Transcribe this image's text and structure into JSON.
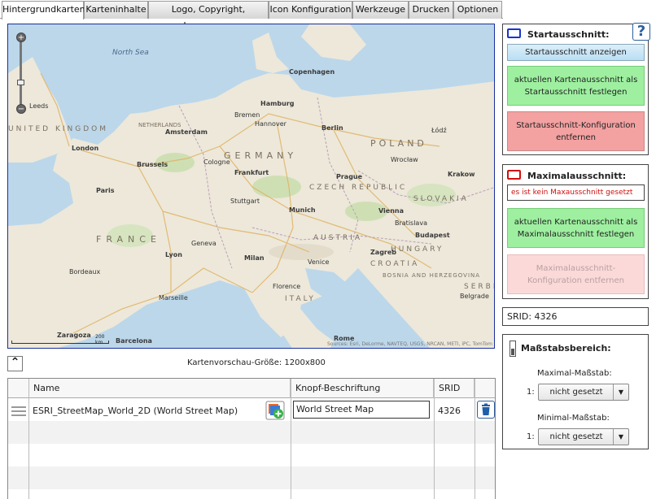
{
  "tabs": [
    {
      "label": "Hintergrundkarten",
      "active": true
    },
    {
      "label": "Karteninhalte",
      "active": false
    },
    {
      "label": "Logo, Copyright, Impressum",
      "active": false
    },
    {
      "label": "Icon Konfiguration",
      "active": false
    },
    {
      "label": "Werkzeuge",
      "active": false
    },
    {
      "label": "Drucken",
      "active": false
    },
    {
      "label": "Optionen",
      "active": false
    }
  ],
  "map": {
    "labels": {
      "north_sea": "North Sea",
      "united_kingdom": "UNITED KINGDOM",
      "netherlands": "NETHERLANDS",
      "france": "FRANCE",
      "germany": "GERMANY",
      "poland": "POLAND",
      "czech": "CZECH REPUBLIC",
      "austria": "AUSTRIA",
      "hungary": "HUNGARY",
      "slovakia": "SLOVAKIA",
      "italy": "ITALY",
      "croatia": "CROATIA",
      "bosnia": "BOSNIA AND HERZEGOVINA",
      "serbia": "SERBIA",
      "london": "London",
      "amsterdam": "Amsterdam",
      "brussels": "Brussels",
      "paris": "Paris",
      "hamburg": "Hamburg",
      "berlin": "Berlin",
      "copenhagen": "Copenhagen",
      "frankfurt": "Frankfurt",
      "prague": "Prague",
      "munich": "Munich",
      "vienna": "Vienna",
      "budapest": "Budapest",
      "milan": "Milan",
      "lyon": "Lyon",
      "zagreb": "Zagreb",
      "krakow": "Krakow",
      "rome": "Rome",
      "barcelona": "Barcelona",
      "zaragoza": "Zaragoza",
      "leeds": "Leeds",
      "bremen": "Bremen",
      "hannover": "Hannover",
      "cologne": "Cologne",
      "stuttgart": "Stuttgart",
      "geneva": "Geneva",
      "venice": "Venice",
      "bordeaux": "Bordeaux",
      "marseille": "Marseille",
      "wroclaw": "Wrocław",
      "lodz": "Łódź",
      "bratislava": "Bratislava",
      "belgrade": "Belgrade",
      "florence": "Florence"
    },
    "scale_label": "200 km",
    "attribution": "Sources: Esri, DeLorme, NAVTEQ, USGS, NRCAN, METI, iPC, TomTom"
  },
  "preview_size": "Kartenvorschau-Größe: 1200x800",
  "table": {
    "headers": {
      "name": "Name",
      "knopf": "Knopf-Beschriftung",
      "srid": "SRID"
    },
    "rows": [
      {
        "name": "ESRI_StreetMap_World_2D (World Street Map)",
        "knopf": "World Street Map",
        "srid": "4326"
      }
    ]
  },
  "start": {
    "title": "Startausschnitt:",
    "show_button": "Startausschnitt anzeigen",
    "set_button": "aktuellen Kartenausschnitt als Startausschnitt festlegen",
    "remove_button": "Startausschnitt-Konfiguration entfernen",
    "color": "#1a35c9"
  },
  "max": {
    "title": "Maximalausschnitt:",
    "info": "es ist kein Maxausschnitt gesetzt",
    "set_button": "aktuellen Kartenausschnitt als Maximalausschnitt festlegen",
    "remove_button": "Maximalausschnitt-Konfiguration entfernen",
    "color": "#d01010"
  },
  "srid_text": "SRID: 4326",
  "scale_range": {
    "title": "Maßstabsbereich:",
    "max_label": "Maximal-Maßstab:",
    "min_label": "Minimal-Maßstab:",
    "prefix": "1:",
    "max_value": "nicht gesetzt",
    "min_value": "nicht gesetzt"
  },
  "help_symbol": "?"
}
